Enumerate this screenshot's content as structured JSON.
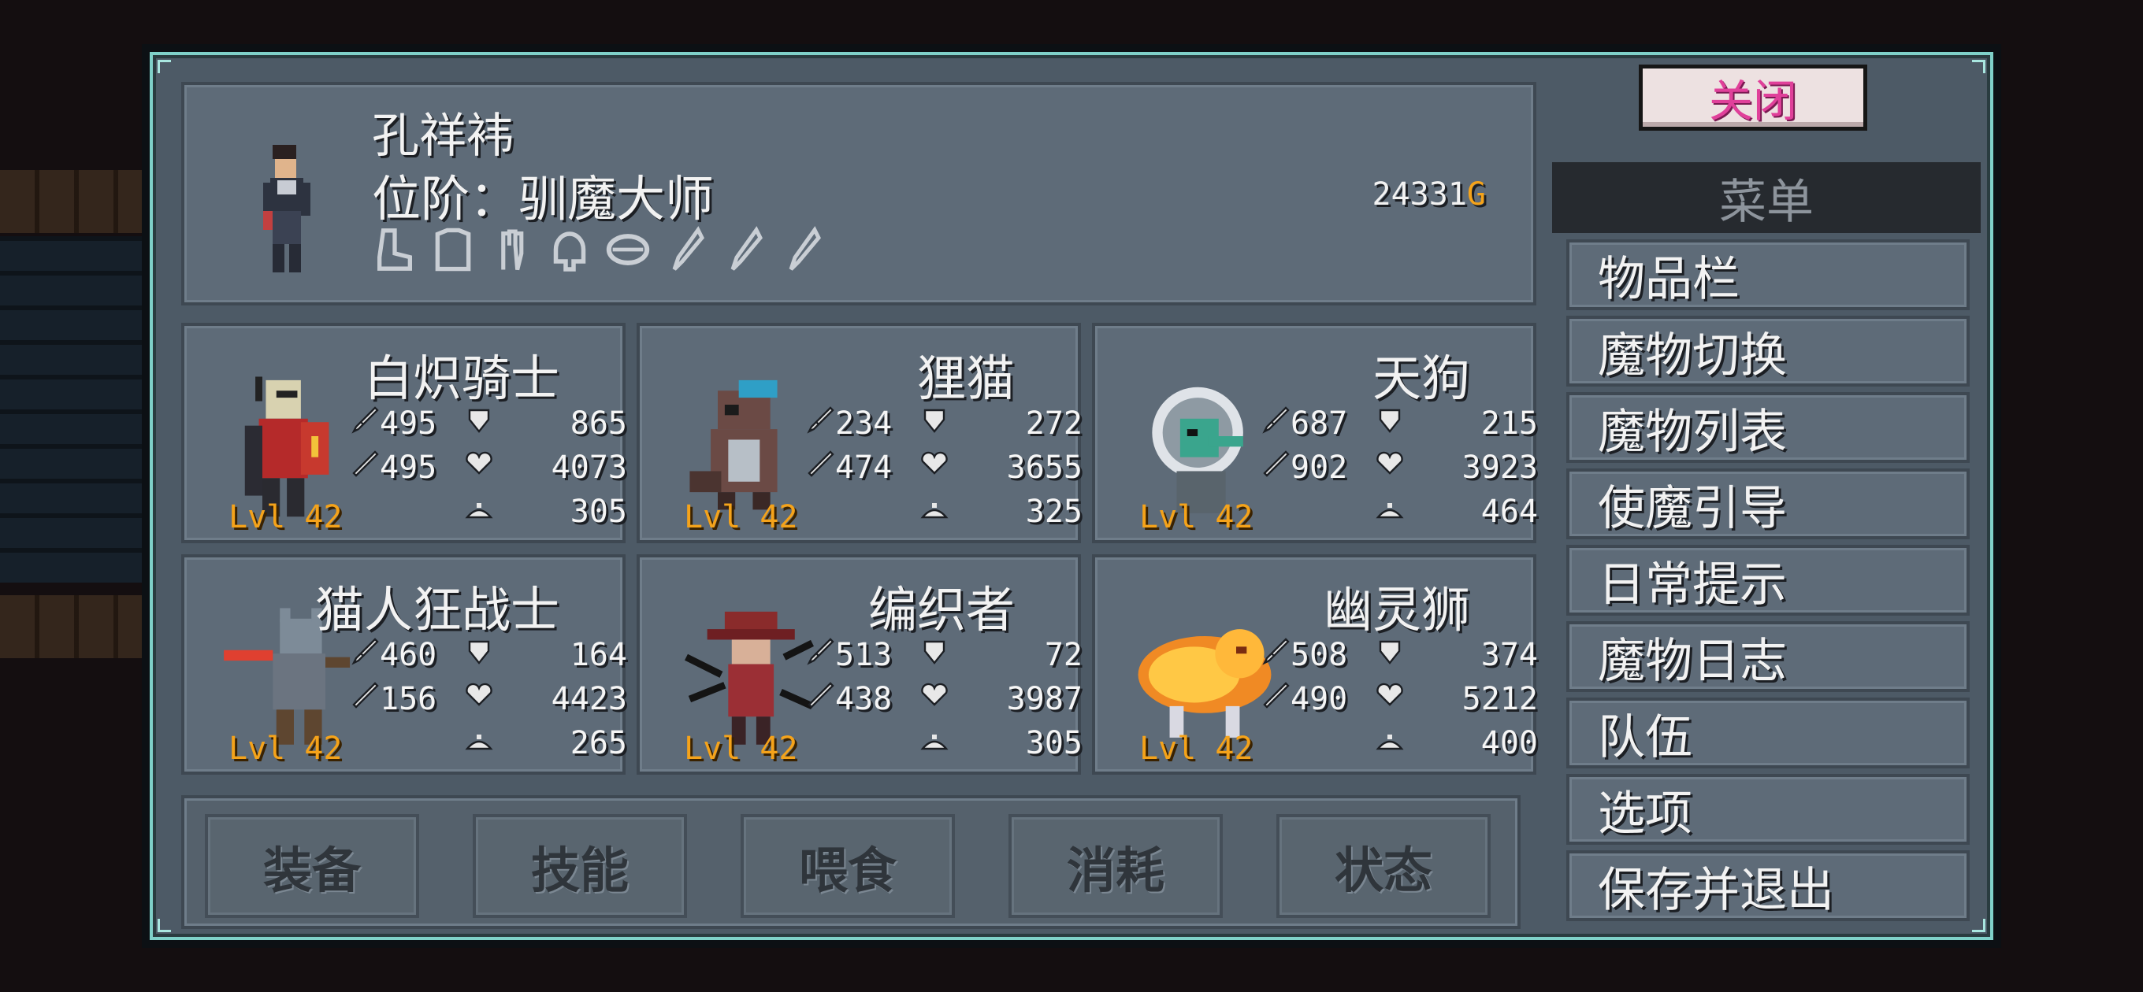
{
  "close_button": "关闭",
  "player": {
    "name": "孔祥袆",
    "rank": "位阶：驯魔大师",
    "gold_amount": "24331",
    "gold_unit": "G",
    "equip_slots": [
      "boot-icon",
      "chest-armor-icon",
      "glove-icon",
      "helmet-icon",
      "ring-icon",
      "feather-icon",
      "feather-icon",
      "feather-icon"
    ]
  },
  "monsters": [
    {
      "name": "白炽骑士",
      "attack": "495",
      "defense": "865",
      "magic": "495",
      "health": "4073",
      "mana": "305",
      "level": "Lvl 42",
      "sprite": "knight"
    },
    {
      "name": "狸猫",
      "attack": "234",
      "defense": "272",
      "magic": "474",
      "health": "3655",
      "mana": "325",
      "level": "Lvl 42",
      "sprite": "raccoon"
    },
    {
      "name": "天狗",
      "attack": "687",
      "defense": "215",
      "magic": "902",
      "health": "3923",
      "mana": "464",
      "level": "Lvl 42",
      "sprite": "tengu"
    },
    {
      "name": "猫人狂战士",
      "attack": "460",
      "defense": "164",
      "magic": "156",
      "health": "4423",
      "mana": "265",
      "level": "Lvl 42",
      "sprite": "catman"
    },
    {
      "name": "编织者",
      "attack": "513",
      "defense": "72",
      "magic": "438",
      "health": "3987",
      "mana": "305",
      "level": "Lvl 42",
      "sprite": "weaver"
    },
    {
      "name": "幽灵狮",
      "attack": "508",
      "defense": "374",
      "magic": "490",
      "health": "5212",
      "mana": "400",
      "level": "Lvl 42",
      "sprite": "lion"
    }
  ],
  "actions": [
    "装备",
    "技能",
    "喂食",
    "消耗",
    "状态"
  ],
  "menu": {
    "header": "菜单",
    "items": [
      "物品栏",
      "魔物切换",
      "魔物列表",
      "使魔引导",
      "日常提示",
      "魔物日志",
      "队伍",
      "选项",
      "保存并退出"
    ]
  },
  "colors": {
    "accent_border": "#7fd1c9",
    "level": "#f5a31a",
    "close_text": "#e0409a"
  }
}
